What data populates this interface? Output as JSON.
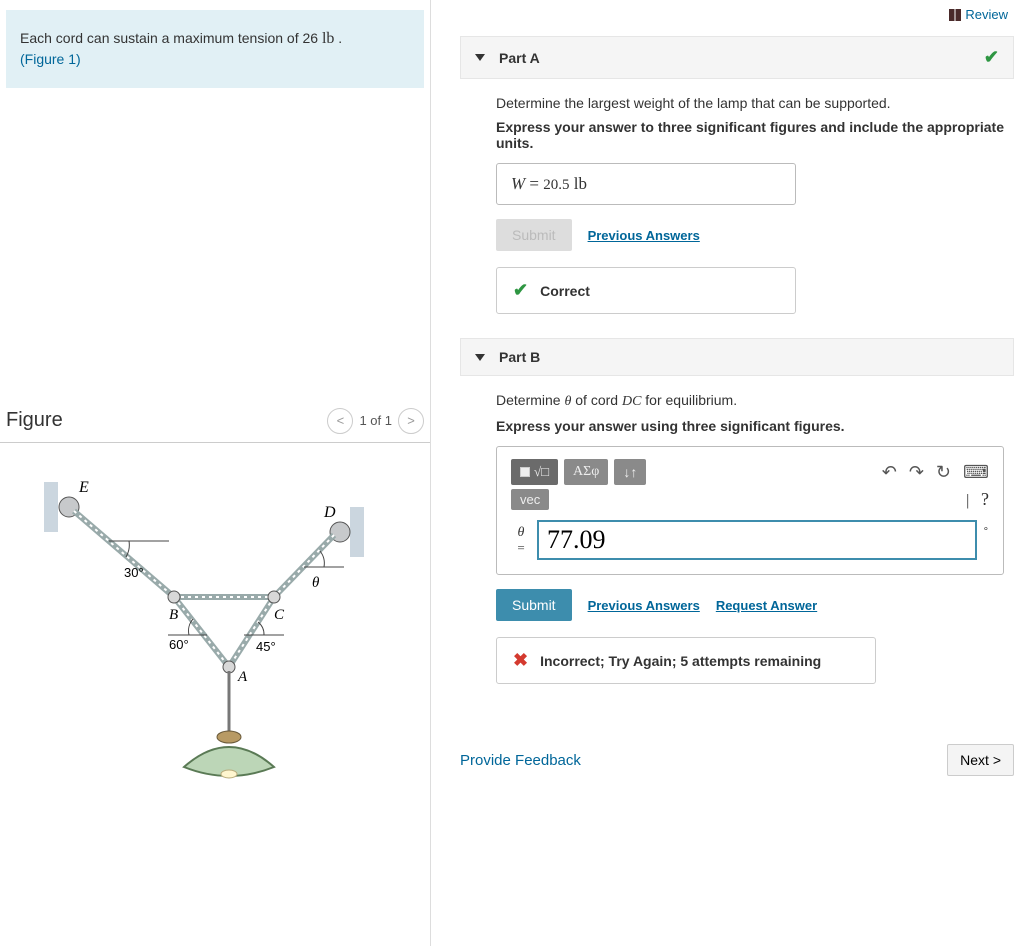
{
  "prompt": {
    "text_before": "Each cord can sustain a maximum tension of 26 ",
    "unit": "lb",
    "text_after": " .",
    "figure_link": "(Figure 1)"
  },
  "figure": {
    "heading": "Figure",
    "counter": "1 of 1",
    "labels": {
      "E": "E",
      "D": "D",
      "B": "B",
      "C": "C",
      "A": "A"
    },
    "angles": {
      "a30": "30°",
      "a60": "60°",
      "a45": "45°",
      "theta": "θ"
    }
  },
  "review_label": "Review",
  "partA": {
    "title": "Part A",
    "instr": "Determine the largest weight of the lamp that can be supported.",
    "bold": "Express your answer to three significant figures and include the appropriate units.",
    "var": "W",
    "eq": " = ",
    "value": "20.5",
    "unit": "lb",
    "submit": "Submit",
    "prev": "Previous Answers",
    "correct": "Correct"
  },
  "partB": {
    "title": "Part B",
    "instr_before": "Determine ",
    "theta": "θ",
    "instr_mid": " of cord ",
    "cord": "DC",
    "instr_after": " for equilibrium.",
    "bold": "Express your answer using three significant figures.",
    "tool_sqrt": "√□",
    "tool_greek": "ΑΣφ",
    "tool_arrows": "↓↑",
    "vec": "vec",
    "help_spacer": "|",
    "help_q": "?",
    "eq_theta": "θ",
    "eq_eq": "=",
    "value": "77.09",
    "deg": "∘",
    "submit": "Submit",
    "prev": "Previous Answers",
    "request": "Request Answer",
    "incorrect": "Incorrect; Try Again; 5 attempts remaining"
  },
  "footer": {
    "feedback": "Provide Feedback",
    "next": "Next >"
  }
}
